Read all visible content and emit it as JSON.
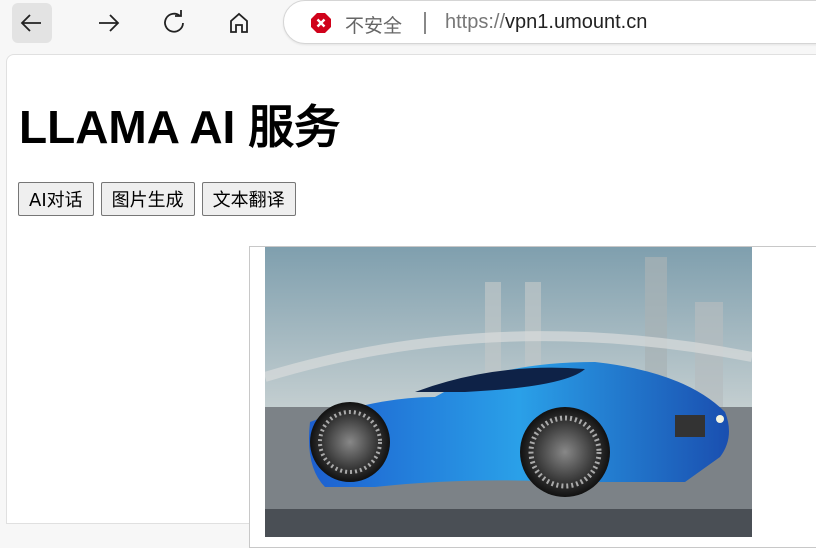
{
  "browser": {
    "security_label": "不安全",
    "url_scheme": "https://",
    "url_host": "vpn1.umount.cn",
    "icons": [
      "back-icon",
      "forward-icon",
      "refresh-icon",
      "home-icon",
      "not-secure-icon"
    ],
    "warn_color": "#d0021b"
  },
  "page": {
    "title": "LLAMA AI 服务",
    "buttons": [
      "AI对话",
      "图片生成",
      "文本翻译"
    ]
  }
}
